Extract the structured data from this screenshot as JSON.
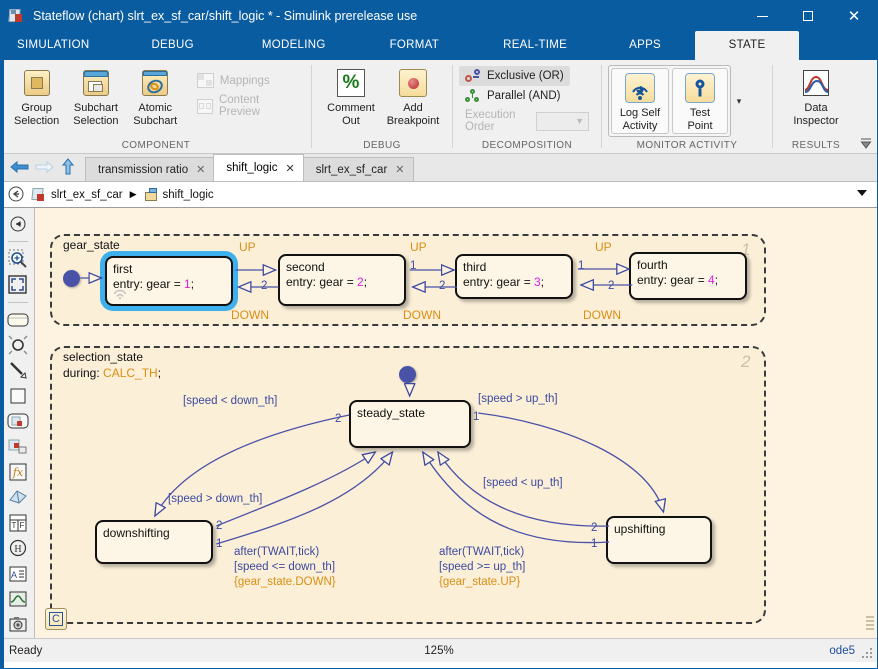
{
  "window": {
    "title": "Stateflow (chart) slrt_ex_sf_car/shift_logic * - Simulink prerelease use",
    "minimize": "─",
    "maximize": "☐",
    "close": "✕"
  },
  "ribbon_tabs": [
    {
      "label": "SIMULATION",
      "active": false
    },
    {
      "label": "DEBUG",
      "active": false
    },
    {
      "label": "MODELING",
      "active": false
    },
    {
      "label": "FORMAT",
      "active": false
    },
    {
      "label": "REAL-TIME",
      "active": false
    },
    {
      "label": "APPS",
      "active": false
    },
    {
      "label": "STATE",
      "active": true
    }
  ],
  "ribbon": {
    "component": {
      "title": "COMPONENT",
      "group_selection": "Group\nSelection",
      "group_selection_l1": "Group",
      "group_selection_l2": "Selection",
      "subchart_selection_l1": "Subchart",
      "subchart_selection_l2": "Selection",
      "atomic_subchart_l1": "Atomic",
      "atomic_subchart_l2": "Subchart",
      "mappings": "Mappings",
      "content_preview": "Content Preview"
    },
    "debug": {
      "title": "DEBUG",
      "comment_out_l1": "Comment",
      "comment_out_l2": "Out",
      "add_breakpoint_l1": "Add",
      "add_breakpoint_l2": "Breakpoint"
    },
    "decomposition": {
      "title": "DECOMPOSITION",
      "exclusive": "Exclusive (OR)",
      "parallel": "Parallel (AND)",
      "execution_order": "Execution Order"
    },
    "monitor": {
      "title": "MONITOR ACTIVITY",
      "log_self_activity_l1": "Log Self",
      "log_self_activity_l2": "Activity",
      "test_point_l1": "Test",
      "test_point_l2": "Point",
      "more": "▾"
    },
    "results": {
      "title": "RESULTS",
      "data_inspector_l1": "Data",
      "data_inspector_l2": "Inspector"
    }
  },
  "editor_tabs": [
    {
      "label": "transmission ratio",
      "close": "✕",
      "active": false
    },
    {
      "label": "shift_logic",
      "close": "✕",
      "active": true
    },
    {
      "label": "slrt_ex_sf_car",
      "close": "✕",
      "active": false
    }
  ],
  "breadcrumb": {
    "root": "slrt_ex_sf_car",
    "separator": "▶",
    "leaf": "shift_logic"
  },
  "palette": [
    {
      "name": "navigate-up-icon"
    },
    {
      "name": "zoom-icon"
    },
    {
      "name": "fit-to-view-icon"
    },
    {
      "name": "state-tool-icon"
    },
    {
      "name": "junction-tool-icon"
    },
    {
      "name": "transition-tool-icon"
    },
    {
      "name": "box-tool-icon"
    },
    {
      "name": "graphical-function-icon"
    },
    {
      "name": "simulink-function-icon"
    },
    {
      "name": "matlab-function-icon"
    },
    {
      "name": "simulink-state-icon"
    },
    {
      "name": "truth-table-icon"
    },
    {
      "name": "history-junction-icon"
    },
    {
      "name": "annotation-icon"
    },
    {
      "name": "scope-icon"
    },
    {
      "name": "camera-icon"
    }
  ],
  "chart": {
    "gear_state": {
      "name": "gear_state",
      "index": "1",
      "states": [
        {
          "name": "first",
          "entry_label": "entry: gear = ",
          "entry_value": "1",
          "semi": ";",
          "selected": true
        },
        {
          "name": "second",
          "entry_label": "entry: gear = ",
          "entry_value": "2",
          "semi": ";",
          "selected": false
        },
        {
          "name": "third",
          "entry_label": "entry: gear = ",
          "entry_value": "3",
          "semi": ";",
          "selected": false
        },
        {
          "name": "fourth",
          "entry_label": "entry: gear = ",
          "entry_value": "4",
          "semi": ";",
          "selected": false
        }
      ],
      "transitions": [
        {
          "label": "UP",
          "order": "1"
        },
        {
          "label": "DOWN",
          "order": "2"
        },
        {
          "label": "UP",
          "order": "1"
        },
        {
          "label": "DOWN",
          "order": "2"
        },
        {
          "label": "UP",
          "order": "1"
        },
        {
          "label": "DOWN",
          "order": "2"
        }
      ]
    },
    "selection_state": {
      "name": "selection_state",
      "index": "2",
      "during_label": "during: ",
      "during_value": "CALC_TH",
      "during_semi": ";",
      "states": [
        {
          "name": "steady_state"
        },
        {
          "name": "downshifting"
        },
        {
          "name": "upshifting"
        }
      ],
      "labels": {
        "speed_lt_down_th": "[speed < down_th]",
        "speed_gt_down_th": "[speed > down_th]",
        "speed_gt_up_th": "[speed > up_th]",
        "speed_lt_up_th": "[speed < up_th]",
        "down_action_l1": "after(TWAIT,tick)",
        "down_action_l2": "[speed <= down_th]",
        "down_action_l3": "{gear_state.DOWN}",
        "up_action_l1": "after(TWAIT,tick)",
        "up_action_l2": "[speed >= up_th]",
        "up_action_l3": "{gear_state.UP}"
      },
      "orders": {
        "steady_to_down": "2",
        "steady_to_up": "1",
        "down_out_2": "2",
        "down_out_1": "1",
        "up_out_2": "2",
        "up_out_1": "1"
      }
    },
    "badge": "C"
  },
  "statusbar": {
    "ready": "Ready",
    "zoom": "125%",
    "solver": "ode5"
  },
  "colors": {
    "titlebar": "#0a5ca0",
    "canvas": "#fdf3e0",
    "superstate_fill": "#fbefd8",
    "state_fill": "#fdf6e6",
    "transition": "#3d4aa0",
    "event_text": "#d98f14",
    "selection": "#3fb0ee",
    "junction": "#4a52a8"
  }
}
